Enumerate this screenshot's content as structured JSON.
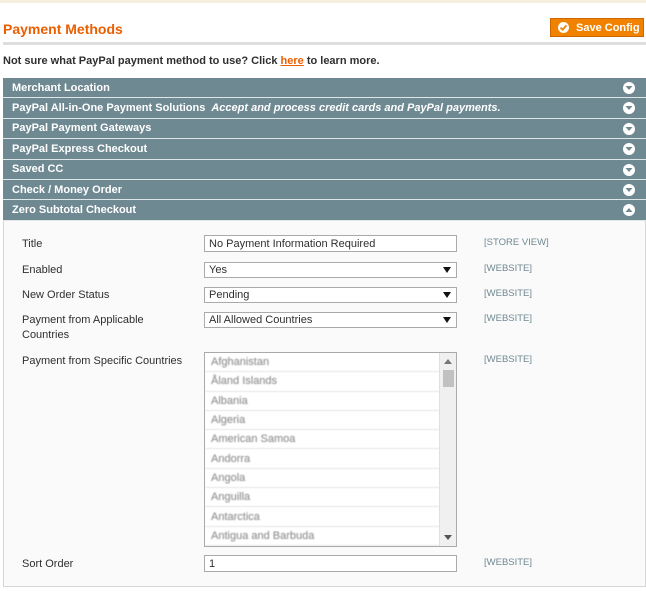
{
  "header": {
    "title": "Payment Methods",
    "save_label": "Save Config"
  },
  "help": {
    "prefix": "Not sure what PayPal payment method to use? Click ",
    "link": "here",
    "suffix": " to learn more."
  },
  "sections": [
    {
      "label": "Merchant Location",
      "desc": "",
      "state": "collapsed"
    },
    {
      "label": "PayPal All-in-One Payment Solutions",
      "desc": "Accept and process credit cards and PayPal payments.",
      "state": "collapsed"
    },
    {
      "label": "PayPal Payment Gateways",
      "desc": "",
      "state": "collapsed"
    },
    {
      "label": "PayPal Express Checkout",
      "desc": "",
      "state": "collapsed"
    },
    {
      "label": "Saved CC",
      "desc": "",
      "state": "collapsed"
    },
    {
      "label": "Check / Money Order",
      "desc": "",
      "state": "collapsed"
    },
    {
      "label": "Zero Subtotal Checkout",
      "desc": "",
      "state": "expanded"
    }
  ],
  "form": {
    "title": {
      "label": "Title",
      "value": "No Payment Information Required",
      "scope": "[STORE VIEW]"
    },
    "enabled": {
      "label": "Enabled",
      "value": "Yes",
      "scope": "[WEBSITE]"
    },
    "order_status": {
      "label": "New Order Status",
      "value": "Pending",
      "scope": "[WEBSITE]"
    },
    "applicable_countries": {
      "label": "Payment from Applicable Countries",
      "value": "All Allowed Countries",
      "scope": "[WEBSITE]"
    },
    "specific_countries": {
      "label": "Payment from Specific Countries",
      "scope": "[WEBSITE]",
      "options": [
        "Afghanistan",
        "Åland Islands",
        "Albania",
        "Algeria",
        "American Samoa",
        "Andorra",
        "Angola",
        "Anguilla",
        "Antarctica",
        "Antigua and Barbuda"
      ]
    },
    "sort_order": {
      "label": "Sort Order",
      "value": "1",
      "scope": "[WEBSITE]"
    }
  },
  "colors": {
    "accent": "#eb5e00",
    "button": "#f18200",
    "section_bar": "#6f8992"
  }
}
